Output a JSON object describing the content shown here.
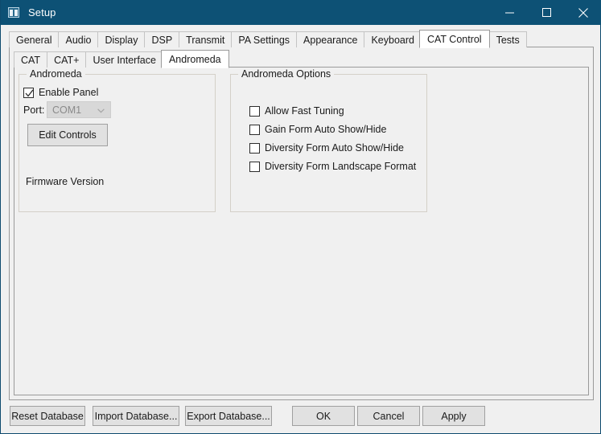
{
  "window": {
    "title": "Setup",
    "icon": "window-panes-icon",
    "accent_color": "#0d5175",
    "background_color": "#f0f0f0",
    "controls": [
      {
        "name": "minimize",
        "glyph": "minimize-icon"
      },
      {
        "name": "maximize",
        "glyph": "maximize-icon"
      },
      {
        "name": "close",
        "glyph": "close-icon"
      }
    ]
  },
  "outer_tabs": {
    "selected": "CAT Control",
    "items": [
      {
        "label": "General"
      },
      {
        "label": "Audio"
      },
      {
        "label": "Display"
      },
      {
        "label": "DSP"
      },
      {
        "label": "Transmit"
      },
      {
        "label": "PA Settings"
      },
      {
        "label": "Appearance"
      },
      {
        "label": "Keyboard"
      },
      {
        "label": "CAT Control"
      },
      {
        "label": "Tests"
      }
    ]
  },
  "inner_tabs": {
    "selected": "Andromeda",
    "items": [
      {
        "label": "CAT"
      },
      {
        "label": "CAT+"
      },
      {
        "label": "User Interface"
      },
      {
        "label": "Andromeda"
      }
    ]
  },
  "andromeda_group": {
    "title": "Andromeda",
    "enable_panel": {
      "label": "Enable Panel",
      "checked": true
    },
    "port": {
      "label": "Port:",
      "value": "COM1",
      "enabled": false
    },
    "edit_controls_button": "Edit Controls",
    "firmware_version_label": "Firmware Version"
  },
  "andromeda_options_group": {
    "title": "Andromeda Options",
    "checkboxes": [
      {
        "label": "Allow Fast Tuning",
        "checked": false
      },
      {
        "label": "Gain Form Auto Show/Hide",
        "checked": false
      },
      {
        "label": "Diversity Form Auto Show/Hide",
        "checked": false
      },
      {
        "label": "Diversity Form Landscape Format",
        "checked": false
      }
    ]
  },
  "bottom_bar": {
    "reset_database": "Reset Database",
    "import_database": "Import Database...",
    "export_database": "Export Database...",
    "ok": "OK",
    "cancel": "Cancel",
    "apply": "Apply"
  }
}
